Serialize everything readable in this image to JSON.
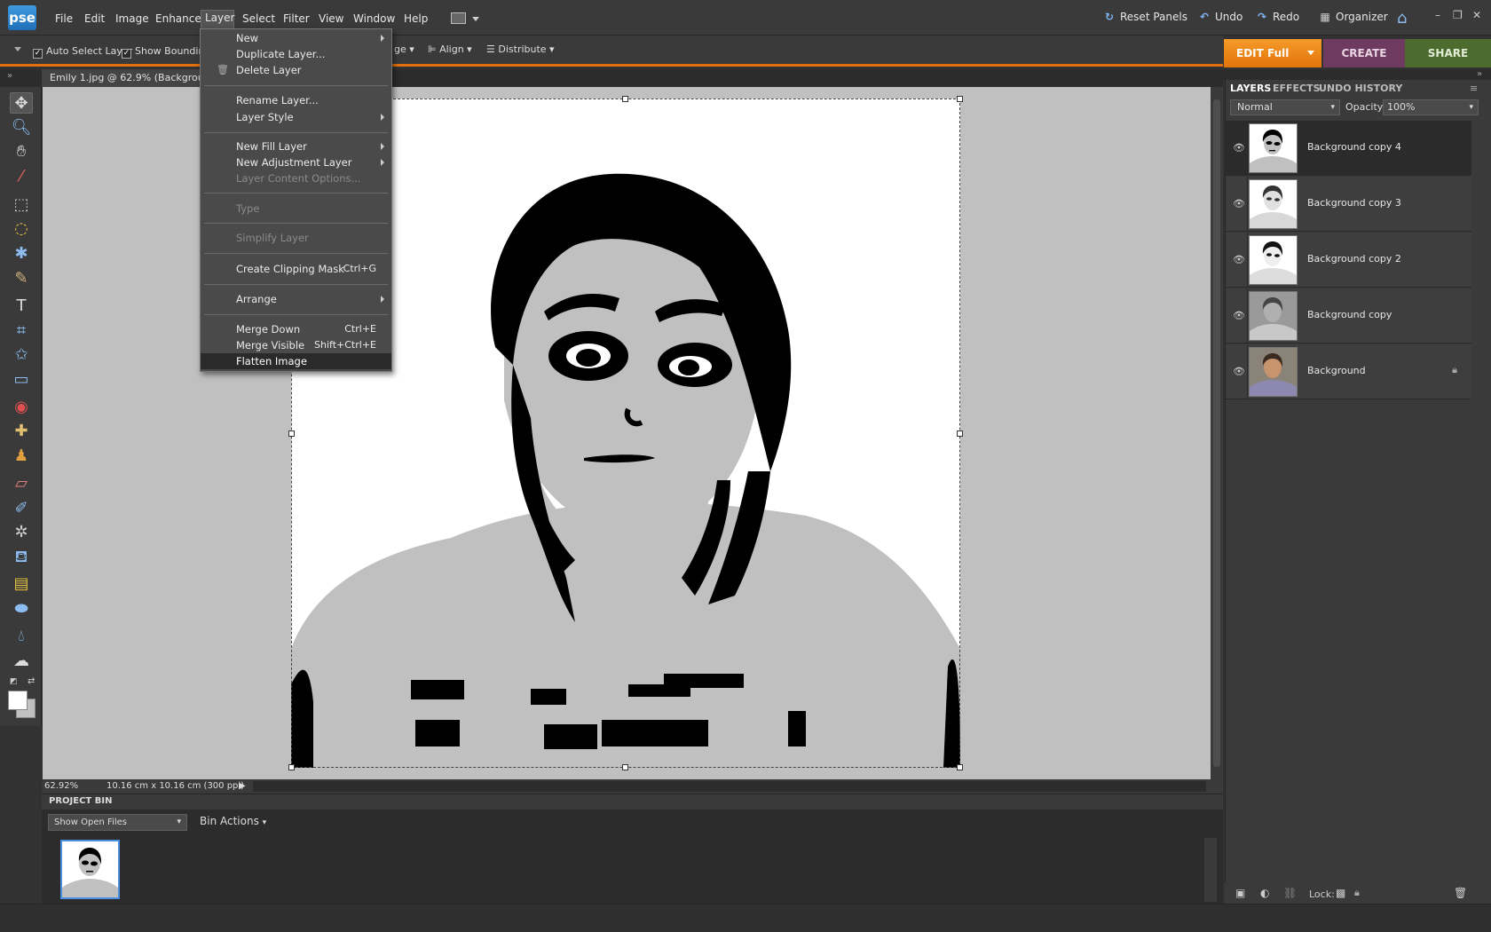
{
  "app": {
    "logo_text": "pse"
  },
  "menubar": {
    "items": [
      "File",
      "Edit",
      "Image",
      "Enhance",
      "Layer",
      "Select",
      "Filter",
      "View",
      "Window",
      "Help"
    ],
    "active": "Layer"
  },
  "top_actions": {
    "reset_panels": "Reset Panels",
    "undo": "Undo",
    "redo": "Redo",
    "organizer": "Organizer"
  },
  "options_bar": {
    "auto_select_layer": "Auto Select Layer",
    "show_bounding": "Show Bounding",
    "arrange_partial": "ge",
    "align": "Align",
    "distribute": "Distribute"
  },
  "mode_tabs": {
    "edit": "EDIT Full",
    "create": "CREATE",
    "share": "SHARE"
  },
  "document": {
    "tab_title": "Emily 1.jpg @ 62.9% (Background copy",
    "zoom": "62.92%",
    "doc_size": "10.16 cm x 10.16 cm (300 ppi)"
  },
  "layer_menu": {
    "items": [
      {
        "label": "New",
        "submenu": true
      },
      {
        "label": "Duplicate Layer..."
      },
      {
        "label": "Delete Layer",
        "icon": "trash-icon"
      },
      {
        "label": "Rename Layer..."
      },
      {
        "label": "Layer Style",
        "submenu": true
      },
      {
        "label": "New Fill Layer",
        "submenu": true
      },
      {
        "label": "New Adjustment Layer",
        "submenu": true
      },
      {
        "label": "Layer Content Options...",
        "disabled": true
      },
      {
        "label": "Type",
        "disabled": true
      },
      {
        "label": "Simplify Layer",
        "disabled": true
      },
      {
        "label": "Create Clipping Mask",
        "shortcut": "Ctrl+G"
      },
      {
        "label": "Arrange",
        "submenu": true
      },
      {
        "label": "Merge Down",
        "shortcut": "Ctrl+E"
      },
      {
        "label": "Merge Visible",
        "shortcut": "Shift+Ctrl+E"
      },
      {
        "label": "Flatten Image",
        "highlighted": true
      }
    ]
  },
  "project_bin": {
    "title": "PROJECT BIN",
    "show_select": "Show Open Files",
    "bin_actions": "Bin Actions"
  },
  "layers_panel": {
    "tabs": [
      "LAYERS",
      "EFFECTS",
      "UNDO HISTORY"
    ],
    "active_tab": "LAYERS",
    "blend_mode": "Normal",
    "opacity_label": "Opacity:",
    "opacity_value": "100%",
    "layers": [
      {
        "name": "Background copy 4",
        "selected": true
      },
      {
        "name": "Background copy 3"
      },
      {
        "name": "Background copy 2"
      },
      {
        "name": "Background copy"
      },
      {
        "name": "Background",
        "locked": true
      }
    ],
    "lock_label": "Lock:"
  },
  "colors": {
    "accent_edit": "#e27409",
    "create": "#6e3a5f",
    "share": "#4b6b2f",
    "canvas_gray": "#c0c0c0",
    "foreground": "#ffffff",
    "background": "#c0c0c0"
  }
}
